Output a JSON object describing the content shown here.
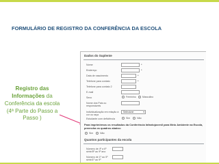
{
  "slide": {
    "title": "FORMULÁRIO DE REGISTRO DA CONFERÊNCIA DA ESCOLA"
  },
  "caption": {
    "line1": "Registro das",
    "line2_bold": "Informações",
    "line2_rest": " da",
    "line3": "Conferência da escola",
    "line4": "(4ª Parte do Passo a",
    "line5": "Passo )"
  },
  "form": {
    "section1_title": "Dados do Suplente",
    "fields": [
      {
        "label": "Nome"
      },
      {
        "label": "Endereço"
      },
      {
        "label": "Data de nascimento"
      },
      {
        "label": "Telefone para contato"
      },
      {
        "label": "Telefone para contato 2"
      },
      {
        "label": "E-mail"
      },
      {
        "label": "Sexo"
      },
      {
        "label": "Nome dos Pais ou responsáveis"
      },
      {
        "label": "Individualização em relação à cor ou raça"
      },
      {
        "label": "Estudante com deficiência"
      }
    ],
    "required_mark": "*",
    "sex_options": [
      "Feminino",
      "Masculino"
    ],
    "yes_no": [
      "Sim",
      "Não"
    ],
    "race_selected": "Selecione",
    "acknowledgement": "Para imprimirmos os resultados da Conferência Infantojuvenil para Meio Ambiente na Escola, preencha os quadros abaixo:",
    "section2_title": "Quantos participantes da escola",
    "participants_fields": [
      {
        "label": "Número de 4º a 6º série/5º ao 9º ano"
      },
      {
        "label": "Número de 1º ao 5º série/1º ao 9º"
      }
    ]
  },
  "colors": {
    "title": "#1f4f7a",
    "caption": "#6aa23a",
    "accent_bar": "#c7d94a",
    "arrow": "#e23c7a"
  }
}
